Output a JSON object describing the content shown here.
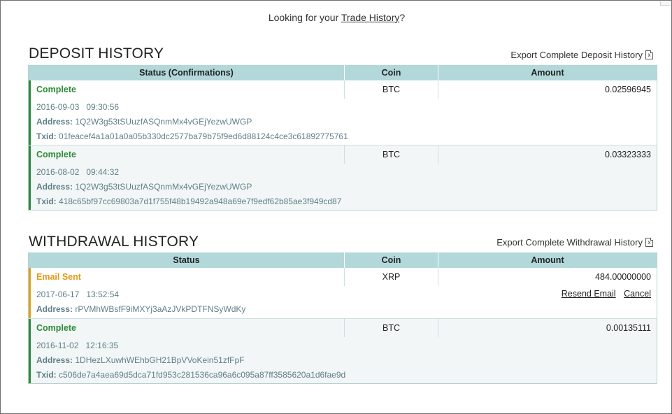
{
  "trade_link": {
    "prefix": "Looking for your ",
    "link": "Trade History",
    "suffix": "?"
  },
  "deposit": {
    "title": "DEPOSIT HISTORY",
    "export_label": "Export Complete Deposit History",
    "columns": [
      "Status (Confirmations)",
      "Coin",
      "Amount"
    ],
    "rows": [
      {
        "status": "Complete",
        "coin": "BTC",
        "amount": "0.02596945",
        "datetime": "2016-09-03   09:30:56",
        "address_label": "Address:",
        "address": "1Q2W3g53tSUuzfASQnmMx4vGEjYezwUWGP",
        "txid_label": "Txid:",
        "txid": "01feacef4a1a01a0a05b330dc2577ba79b75f9ed6d88124c4ce3c61892775761"
      },
      {
        "status": "Complete",
        "coin": "BTC",
        "amount": "0.03323333",
        "datetime": "2016-08-02   09:44:32",
        "address_label": "Address:",
        "address": "1Q2W3g53tSUuzfASQnmMx4vGEjYezwUWGP",
        "txid_label": "Txid:",
        "txid": "418c65bf97cc69803a7d1f755f48b19492a948a69e7f9edf62b85ae3f949cd87"
      }
    ]
  },
  "withdrawal": {
    "title": "WITHDRAWAL HISTORY",
    "export_label": "Export Complete Withdrawal History",
    "columns": [
      "Status",
      "Coin",
      "Amount"
    ],
    "rows": [
      {
        "status": "Email Sent",
        "coin": "XRP",
        "amount": "484.00000000",
        "datetime": "2017-06-17   13:52:54",
        "address_label": "Address:",
        "address": "rPVMhWBsfF9iMXYj3aAzJVkPDTFNSyWdKy",
        "resend_label": "Resend Email",
        "cancel_label": "Cancel"
      },
      {
        "status": "Complete",
        "coin": "BTC",
        "amount": "0.00135111",
        "datetime": "2016-11-02   12:16:35",
        "address_label": "Address:",
        "address": "1DHezLXuwhWEhbGH21BpVVoKein51zfFpF",
        "txid_label": "Txid:",
        "txid": "c506de7a4aea69d5dca71fd953c281536ca96a6c095a87ff3585620a1d6fae9d"
      }
    ]
  },
  "colors": {
    "complete": "#2e8b3a",
    "pending": "#e39a17",
    "header_bg": "#b2d8da"
  },
  "icons": {
    "export": "excel-file-icon"
  }
}
